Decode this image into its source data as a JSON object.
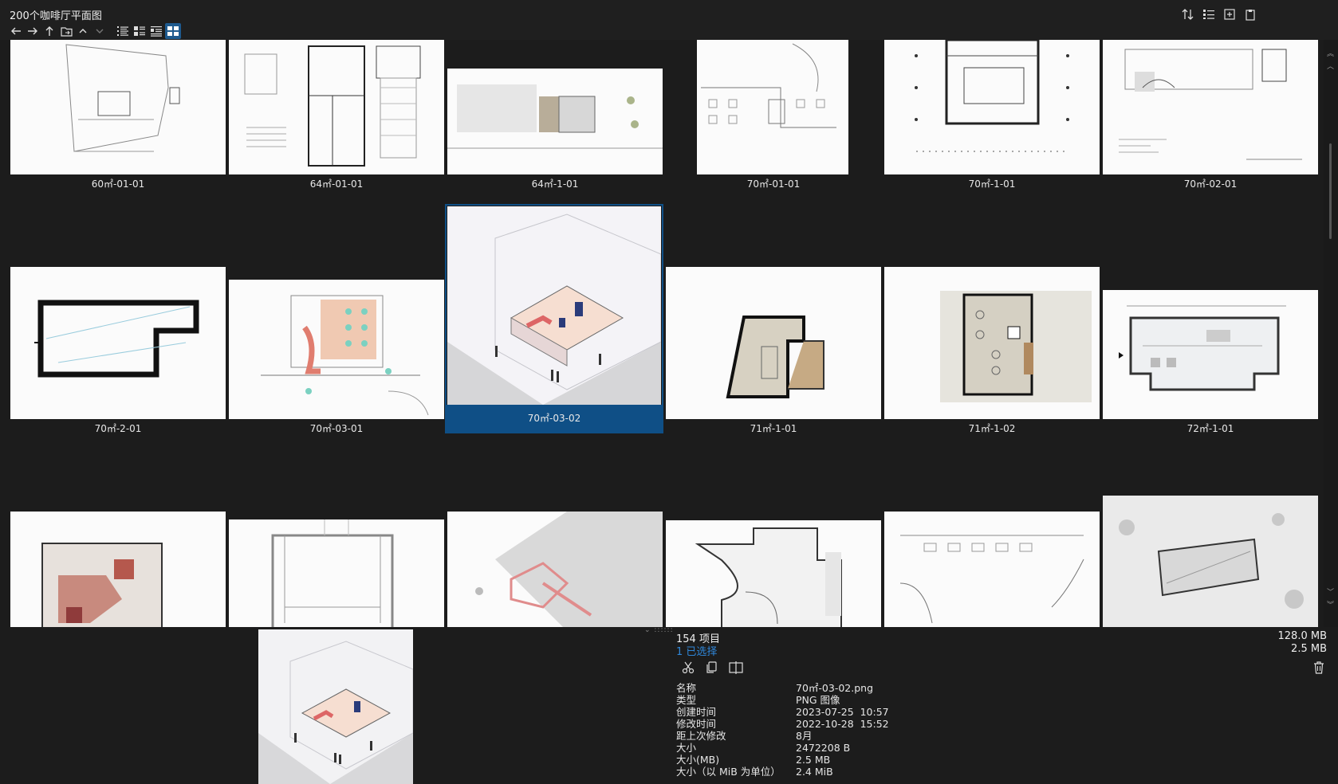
{
  "window": {
    "title": "200个咖啡厅平面图"
  },
  "toolbar": {
    "nav_icons": [
      "back-arrow-icon",
      "forward-arrow-icon",
      "up-arrow-icon",
      "folder-icon",
      "chevron-up-icon",
      "chevron-down-icon"
    ],
    "view_icons": [
      "list-view-icon",
      "detail-view-icon",
      "tile-view-icon",
      "thumbnail-view-icon"
    ],
    "active_view": "thumbnail-view-icon",
    "right_icons": [
      "sort-icon",
      "layout-icon",
      "new-tab-icon",
      "clipboard-icon"
    ]
  },
  "grid": {
    "items": [
      {
        "label": "60㎡-01-01"
      },
      {
        "label": "64㎡-01-01"
      },
      {
        "label": "64㎡-1-01"
      },
      {
        "label": "70㎡-01-01"
      },
      {
        "label": "70㎡-1-01"
      },
      {
        "label": "70㎡-02-01"
      },
      {
        "label": "70㎡-2-01"
      },
      {
        "label": "70㎡-03-01"
      },
      {
        "label": "70㎡-03-02",
        "selected": true
      },
      {
        "label": "71㎡-1-01"
      },
      {
        "label": "71㎡-1-02"
      },
      {
        "label": "72㎡-1-01"
      },
      {
        "label": ""
      },
      {
        "label": ""
      },
      {
        "label": ""
      },
      {
        "label": ""
      },
      {
        "label": ""
      },
      {
        "label": ""
      }
    ]
  },
  "info": {
    "item_count": "154 项目",
    "selected_count": "1 已选择",
    "total_size": "128.0 MB",
    "selected_size": "2.5 MB",
    "action_icons": [
      "cut-icon",
      "copy-icon",
      "compare-icon"
    ],
    "properties": [
      {
        "key": "名称",
        "value": "70㎡-03-02.png"
      },
      {
        "key": "类型",
        "value": "PNG 图像"
      },
      {
        "key": "创建时间",
        "value": "2023-07-25  10:57"
      },
      {
        "key": "修改时间",
        "value": "2022-10-28  15:52"
      },
      {
        "key": "距上次修改",
        "value": "8月"
      },
      {
        "key": "大小",
        "value": "2472208 B"
      },
      {
        "key": "大小(MB)",
        "value": "2.5 MB"
      },
      {
        "key": "大小（以 MiB 为单位）",
        "value": "2.4 MiB"
      }
    ]
  },
  "colors": {
    "background": "#1c1c1c",
    "selection": "#0f4f86",
    "accent_text": "#2f86d8"
  }
}
